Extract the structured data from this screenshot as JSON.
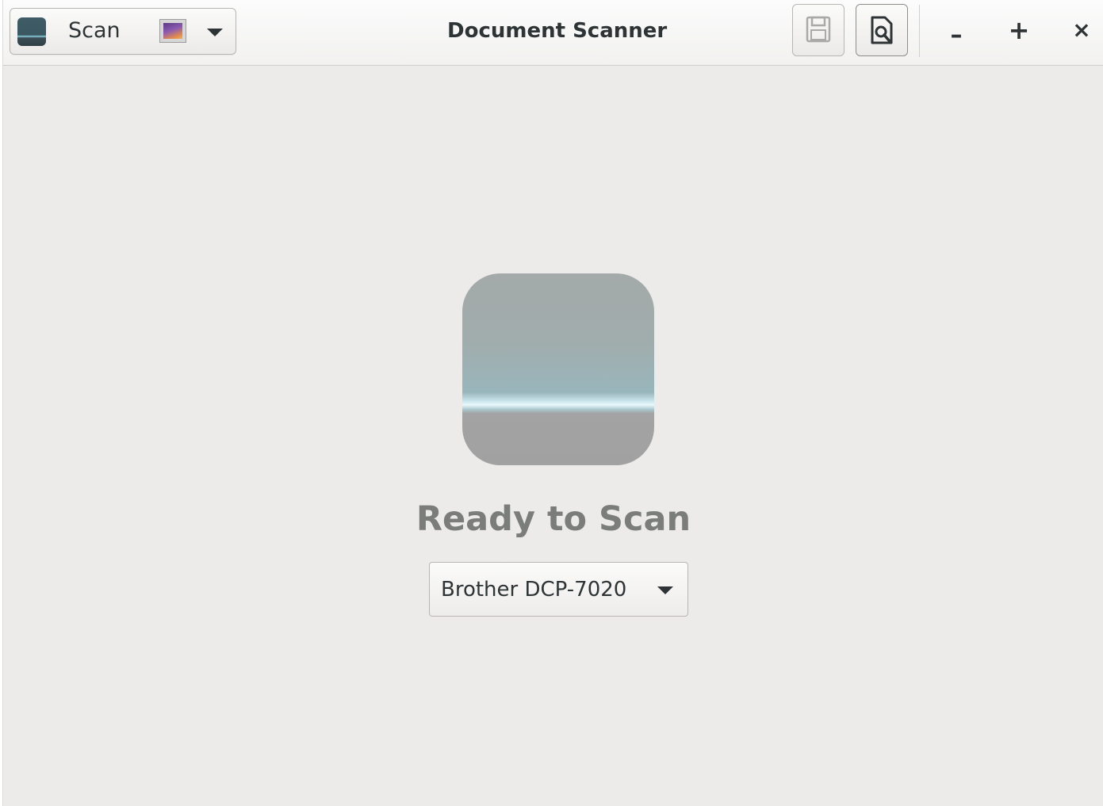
{
  "window": {
    "title": "Document Scanner"
  },
  "headerbar": {
    "scan_button": {
      "label": "Scan",
      "icon": "scanner-icon"
    },
    "scan_type_menu": {
      "icon": "photo-icon",
      "arrow_icon": "chevron-down-icon"
    },
    "save_button": {
      "icon": "floppy-disk-icon"
    },
    "preview_button": {
      "icon": "document-preview-icon"
    },
    "window_controls": {
      "minimize": "–",
      "maximize": "+",
      "close": "×"
    }
  },
  "main": {
    "status_text": "Ready to Scan",
    "device_select": {
      "selected": "Brother DCP-7020",
      "arrow_icon": "chevron-down-icon"
    }
  },
  "colors": {
    "window_bg": "#edebe9",
    "status_text": "#7b7d7b",
    "text": "#2e3436"
  }
}
